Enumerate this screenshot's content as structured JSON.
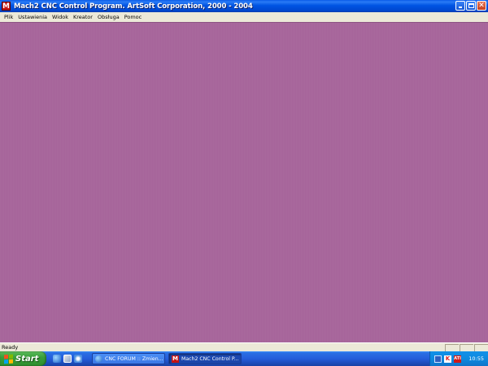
{
  "window": {
    "title": "Mach2 CNC Control Program. ArtSoft Corporation, 2000 - 2004",
    "app_icon": "mach2-icon",
    "app_icon_letter": "M",
    "controls": [
      "minimize",
      "maximize",
      "close"
    ],
    "close_glyph": "✕"
  },
  "menu": {
    "items": [
      {
        "label": "Plik"
      },
      {
        "label": "Ustawienia"
      },
      {
        "label": "Widok"
      },
      {
        "label": "Kreator"
      },
      {
        "label": "Obsługa"
      },
      {
        "label": "Pomoc"
      }
    ]
  },
  "client": {
    "background_color": "#A6649A"
  },
  "statusbar": {
    "text": "Ready"
  },
  "taskbar": {
    "start_label": "Start",
    "quicklaunch": [
      "browser-icon",
      "desktop-icon",
      "media-icon"
    ],
    "tasks": [
      {
        "label": "CNC FORUM :: Zmien...",
        "icon": "browser-icon",
        "active": false
      },
      {
        "label": "Mach2 CNC Control P...",
        "icon": "mach2-icon",
        "active": true
      }
    ],
    "tray_icons": [
      "network-icon",
      "antivirus-icon",
      "ati-icon"
    ],
    "clock": "10:55"
  }
}
